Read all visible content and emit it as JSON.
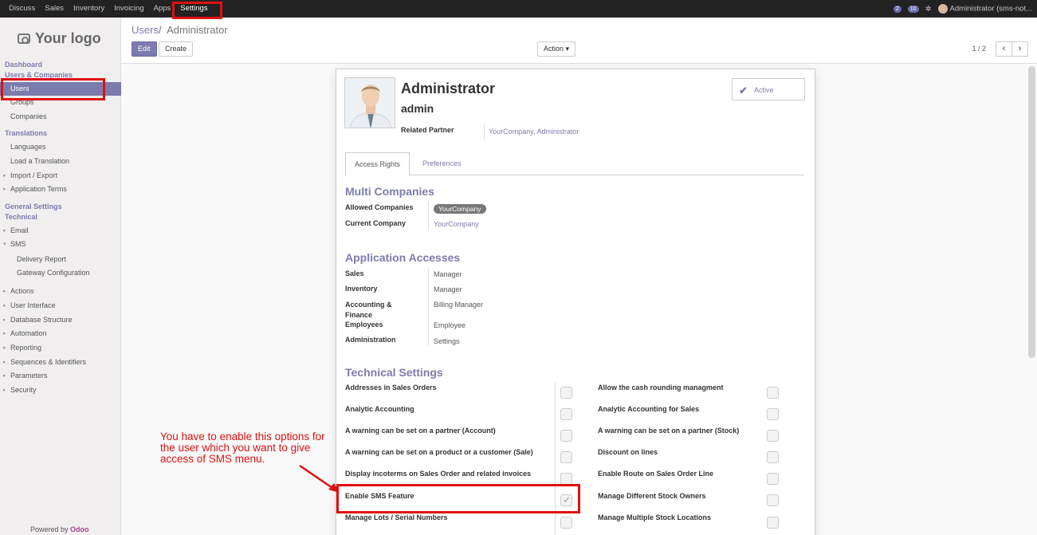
{
  "topbar": {
    "menu": [
      "Discuss",
      "Sales",
      "Inventory",
      "Invoicing",
      "Apps",
      "Settings"
    ],
    "badge1": "2",
    "badge2": "10",
    "user": "Administrator (sms-not..."
  },
  "sidebar": {
    "logo": "Your logo",
    "dashboard": "Dashboard",
    "users_companies": "Users & Companies",
    "users": "Users",
    "groups": "Groups",
    "companies": "Companies",
    "translations": "Translations",
    "languages": "Languages",
    "load_translation": "Load a Translation",
    "import_export": "Import / Export",
    "application_terms": "Application Terms",
    "general_settings": "General Settings",
    "technical": "Technical",
    "email": "Email",
    "sms": "SMS",
    "delivery_report": "Delivery Report",
    "gateway_configuration": "Gateway Configuration",
    "actions": "Actions",
    "user_interface": "User Interface",
    "database_structure": "Database Structure",
    "automation": "Automation",
    "reporting": "Reporting",
    "sequences": "Sequences & Identifiers",
    "parameters": "Parameters",
    "security": "Security",
    "powered_by": "Powered by",
    "odoo": "Odoo"
  },
  "control_panel": {
    "breadcrumb_parent": "Users",
    "breadcrumb_sep": "/",
    "breadcrumb_current": "Administrator",
    "edit": "Edit",
    "create": "Create",
    "action": "Action ▾",
    "pager": "1 / 2",
    "prev": "‹",
    "next": "›"
  },
  "form": {
    "name": "Administrator",
    "login": "admin",
    "related_partner_label": "Related Partner",
    "related_partner": "YourCompany, Administrator",
    "active": "Active",
    "tab_access": "Access Rights",
    "tab_prefs": "Preferences",
    "multi_companies": "Multi Companies",
    "allowed_companies_label": "Allowed Companies",
    "allowed_companies": "YourCompany",
    "current_company_label": "Current Company",
    "current_company": "YourCompany",
    "app_accesses": "Application Accesses",
    "apps": [
      {
        "label": "Sales",
        "value": "Manager"
      },
      {
        "label": "Inventory",
        "value": "Manager"
      },
      {
        "label": "Accounting & Finance",
        "value": "Billing Manager"
      },
      {
        "label": "Employees",
        "value": "Employee"
      },
      {
        "label": "Administration",
        "value": "Settings"
      }
    ],
    "technical_settings": "Technical Settings",
    "tech_left": [
      {
        "label": "Addresses in Sales Orders",
        "checked": false
      },
      {
        "label": "Analytic Accounting",
        "checked": false
      },
      {
        "label": "A warning can be set on a partner (Account)",
        "checked": false
      },
      {
        "label": "A warning can be set on a product or a customer (Sale)",
        "checked": false
      },
      {
        "label": "Display incoterms on Sales Order and related invoices",
        "checked": false
      },
      {
        "label": "Enable SMS Feature",
        "checked": true
      },
      {
        "label": "Manage Lots / Serial Numbers",
        "checked": false
      }
    ],
    "tech_right": [
      {
        "label": "Allow the cash rounding managment",
        "checked": false
      },
      {
        "label": "Analytic Accounting for Sales",
        "checked": false
      },
      {
        "label": "A warning can be set on a partner (Stock)",
        "checked": false
      },
      {
        "label": "Discount on lines",
        "checked": false
      },
      {
        "label": "Enable Route on Sales Order Line",
        "checked": false
      },
      {
        "label": "Manage Different Stock Owners",
        "checked": false
      },
      {
        "label": "Manage Multiple Stock Locations",
        "checked": false
      }
    ]
  },
  "annotation": {
    "note": "You have to enable this options for the user which you want to give access of SMS menu."
  }
}
